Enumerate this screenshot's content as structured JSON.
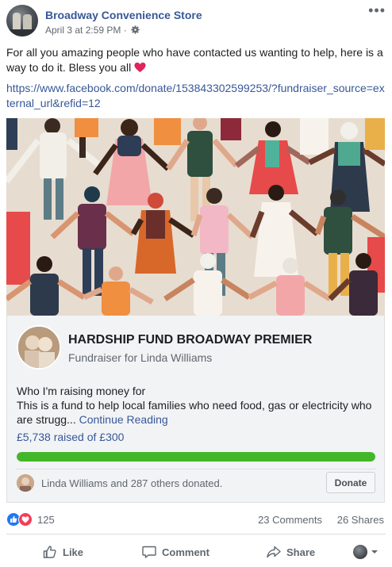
{
  "post": {
    "page_name": "Broadway Convenience Store",
    "timestamp": "April 3 at 2:59 PM",
    "separator": " · ",
    "text": "For all you amazing people who have contacted us wanting to help, here is a way to do it. Bless you all",
    "link": "https://www.facebook.com/donate/153843302599253/?fundraiser_source=external_url&refid=12",
    "more_label": "•••"
  },
  "fundraiser": {
    "title": "HARDSHIP FUND BROADWAY PREMIER",
    "subtitle": "Fundraiser for Linda Williams",
    "desc_line1": "Who I'm raising money for",
    "desc_line2": "This is a fund to help local families who need food, gas or electricity who are strugg...",
    "continue_label": "Continue Reading",
    "raised_text": "£5,738 raised of £300",
    "progress_fraction": 1.0,
    "donors_text": "Linda Williams and 287 others donated.",
    "donate_label": "Donate"
  },
  "reactions": {
    "count": "125",
    "comments": "23 Comments",
    "shares": "26 Shares"
  },
  "actions": {
    "like": "Like",
    "comment": "Comment",
    "share": "Share"
  },
  "colors": {
    "link": "#385898",
    "progress": "#42b72a",
    "like": "#2078f4",
    "love": "#f33e58"
  }
}
